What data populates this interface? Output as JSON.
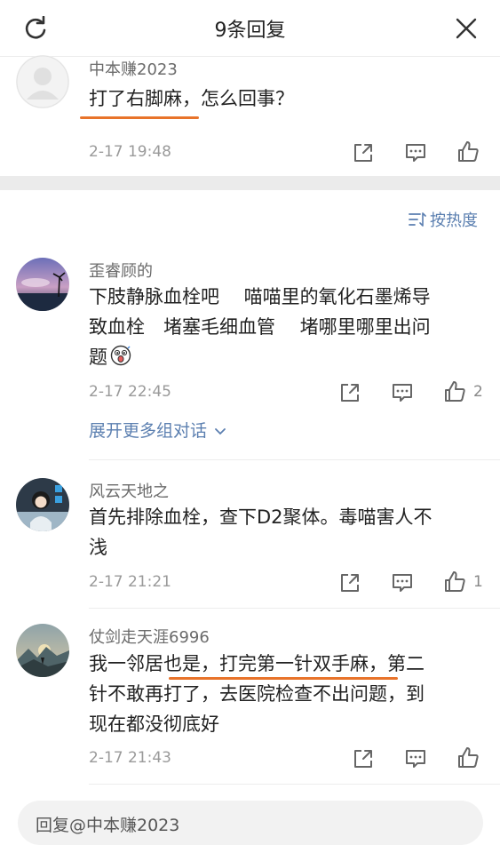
{
  "header": {
    "title": "9条回复"
  },
  "root_comment": {
    "username": "中本赚2023",
    "text": "打了右脚麻，怎么回事？",
    "time": "2-17 19:48"
  },
  "sort": {
    "label": "按热度"
  },
  "replies": [
    {
      "username": "歪睿顾的",
      "text_lines": [
        "下肢静脉血栓吧　 喵喵里的氧化石墨烯导",
        "致血栓　堵塞毛细血管　 堵哪里哪里出问",
        "题"
      ],
      "time": "2-17 22:45",
      "likes": "2"
    },
    {
      "username": "风云天地之",
      "text_lines": [
        "首先排除血栓，查下D2聚体。毒喵害人不",
        "浅"
      ],
      "time": "2-17 21:21",
      "likes": "1"
    },
    {
      "username": "仗剑走天涯6996",
      "text_lines": [
        "我一邻居也是，打完第一针双手麻，第二",
        "针不敢再打了，去医院检查不出问题，到",
        "现在都没彻底好"
      ],
      "time": "2-17 21:43",
      "likes": ""
    }
  ],
  "expand": {
    "label": "展开更多组对话"
  },
  "reply_input": {
    "placeholder": "回复@中本赚2023"
  },
  "colors": {
    "accent": "#5b7fb0",
    "underline": "#e8732a"
  }
}
